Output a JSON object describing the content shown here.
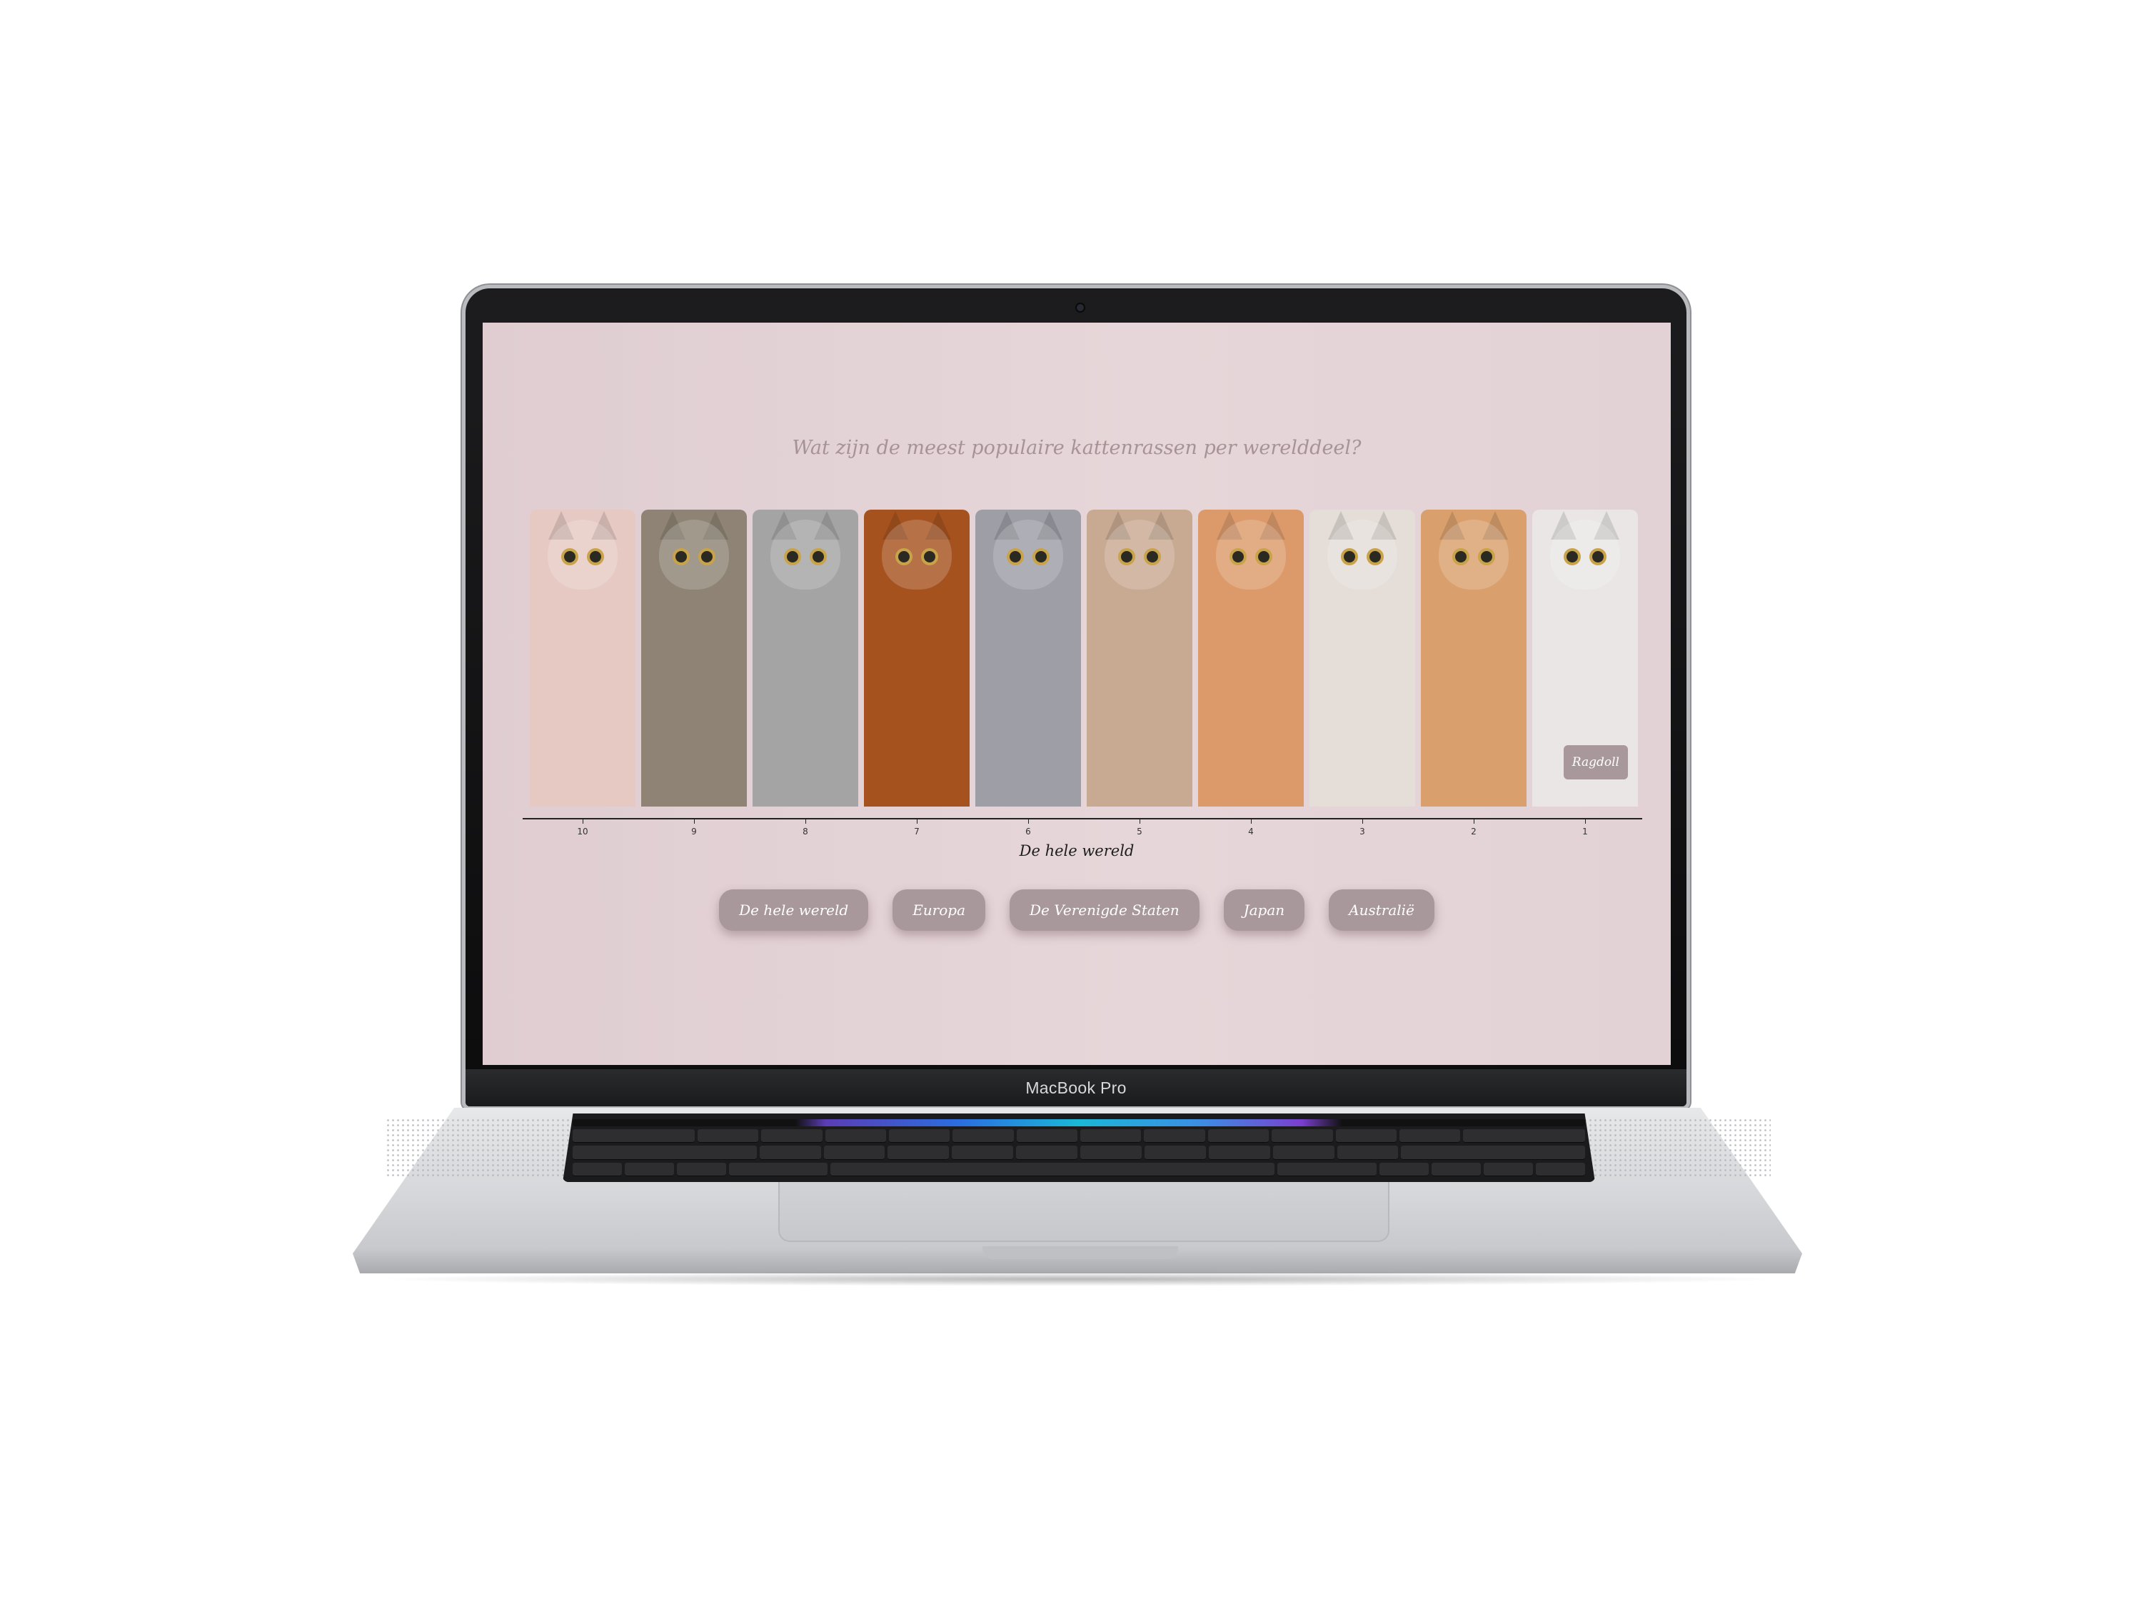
{
  "device": {
    "brand": "MacBook Pro"
  },
  "page": {
    "title": "Wat zijn de meest populaire kattenrassen per werelddeel?",
    "active_region": "De hele wereld",
    "hover_label": "Ragdoll",
    "colors": {
      "background": "#e2d1d5",
      "button": "#a8979b",
      "button_text": "#ffffff",
      "title": "#a69297"
    }
  },
  "chart_data": {
    "type": "bar",
    "xlabel": "De hele wereld",
    "categories": [
      "10",
      "9",
      "8",
      "7",
      "6",
      "5",
      "4",
      "3",
      "2",
      "1"
    ],
    "bars": [
      {
        "rank": "10",
        "color": "#e6c9c2",
        "icon": "hairless-cat"
      },
      {
        "rank": "9",
        "color": "#8e8374",
        "icon": "tabby-fold-cat"
      },
      {
        "rank": "8",
        "color": "#a3a4a3",
        "icon": "silver-tabby-cat"
      },
      {
        "rank": "7",
        "color": "#a6521f",
        "icon": "ruddy-cat"
      },
      {
        "rank": "6",
        "color": "#9d9ea6",
        "icon": "blue-grey-cat"
      },
      {
        "rank": "5",
        "color": "#c8a992",
        "icon": "point-cat"
      },
      {
        "rank": "4",
        "color": "#dc9a6b",
        "icon": "red-longhair-cat"
      },
      {
        "rank": "3",
        "color": "#e4ddd8",
        "icon": "calico-flatface-cat"
      },
      {
        "rank": "2",
        "color": "#d9a06d",
        "icon": "red-fluffy-cat"
      },
      {
        "rank": "1",
        "color": "#eae6e6",
        "icon": "ragdoll-cat"
      }
    ]
  },
  "buttons": [
    {
      "label": "De hele wereld"
    },
    {
      "label": "Europa"
    },
    {
      "label": "De Verenigde Staten"
    },
    {
      "label": "Japan"
    },
    {
      "label": "Australië"
    }
  ]
}
